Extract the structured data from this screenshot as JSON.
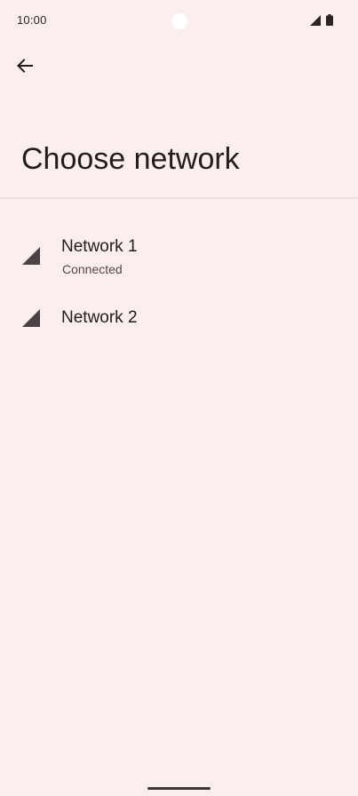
{
  "status_bar": {
    "time": "10:00"
  },
  "header": {
    "back_icon": "arrow-back-icon",
    "title": "Choose network"
  },
  "networks": [
    {
      "name": "Network 1",
      "status": "Connected",
      "icon": "signal-icon"
    },
    {
      "name": "Network 2",
      "icon": "signal-icon"
    }
  ],
  "colors": {
    "background": "#fbeeee",
    "text": "#221c1d",
    "icon": "#4a4244"
  }
}
